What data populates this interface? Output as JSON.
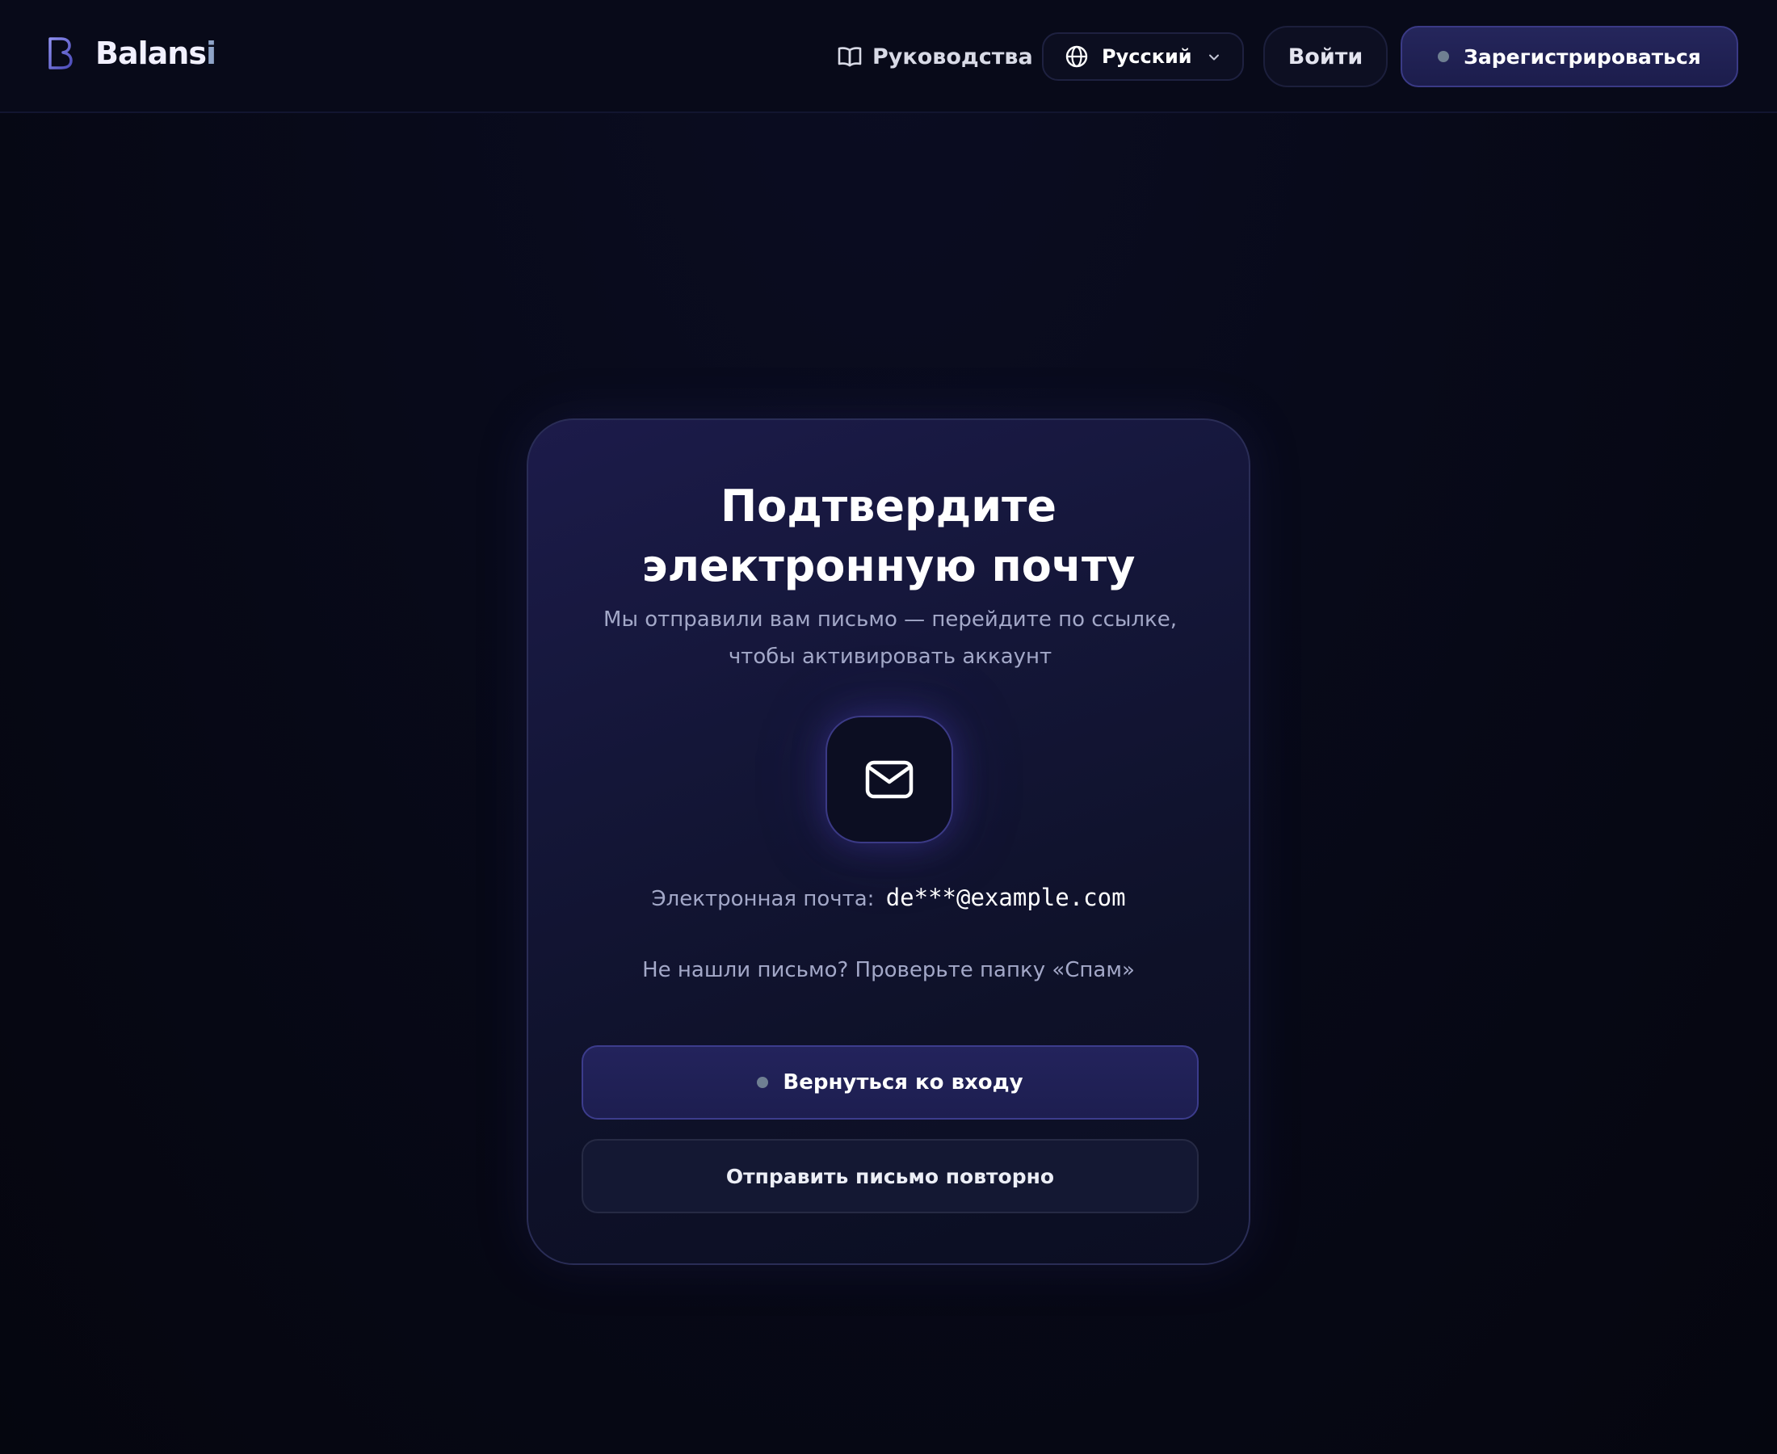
{
  "header": {
    "logo": {
      "mark_icon": "letter-b-logo-icon",
      "name_main": "Balans",
      "name_accent": "i"
    },
    "nav": {
      "guides_label": "Руководства",
      "guides_icon": "open-book-icon"
    },
    "language": {
      "selected": "Русский",
      "icon": "globe-icon",
      "dropdown_icon": "chevron-down-icon"
    },
    "login_label": "Войти",
    "register_label": "Зарегистрироваться"
  },
  "card": {
    "title_line1": "Подтвердите",
    "title_line2": "электронную почту",
    "subtitle_line1": "Мы отправили вам письмо — перейдите по ссылке,",
    "subtitle_line2": "чтобы активировать аккаунт",
    "icon": "mail-envelope-icon",
    "email_label": "Электронная почта:",
    "email_value": "de***@example.com",
    "spam_hint": "Не нашли письмо? Проверьте папку «Спам»",
    "back_button": "Вернуться ко входу",
    "resend_button": "Отправить письмо повторно"
  },
  "colors": {
    "background": "#060712",
    "card_border": "#2a2d56",
    "primary_button": "#1f1f54",
    "primary_border": "#3c3c8c",
    "muted_text": "#a3a8c8",
    "status_dot": "#6f7f92"
  }
}
